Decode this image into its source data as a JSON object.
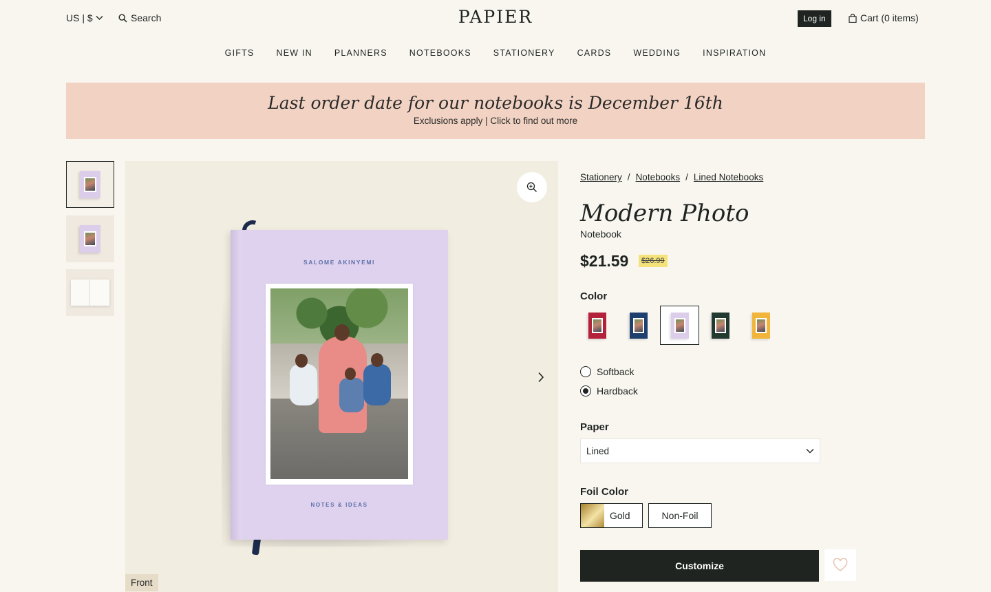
{
  "header": {
    "locale": "US | $",
    "search_label": "Search",
    "logo": "PAPIER",
    "login_label": "Log in",
    "cart_label": "Cart (0 items)"
  },
  "nav": [
    "GIFTS",
    "NEW IN",
    "PLANNERS",
    "NOTEBOOKS",
    "STATIONERY",
    "CARDS",
    "WEDDING",
    "INSPIRATION"
  ],
  "banner": {
    "title": "Last order date for our notebooks is December 16th",
    "subtitle": "Exclusions apply | Click to find out more",
    "color": "#f2d3c3"
  },
  "gallery": {
    "thumbnails": [
      "front-cover",
      "back-cover",
      "open-pages"
    ],
    "active_thumbnail": 0,
    "cover_author": "SALOME AKINYEMI",
    "cover_footer": "NOTES & IDEAS",
    "view_label": "Front"
  },
  "breadcrumb": [
    "Stationery",
    "Notebooks",
    "Lined Notebooks"
  ],
  "product": {
    "title": "Modern Photo",
    "subtitle": "Notebook",
    "price": "$21.59",
    "old_price": "$26.99"
  },
  "color": {
    "label": "Color",
    "options": [
      {
        "name": "red",
        "hex": "#b3213a"
      },
      {
        "name": "navy",
        "hex": "#1f3f6e"
      },
      {
        "name": "lilac",
        "hex": "#dccdea"
      },
      {
        "name": "forest",
        "hex": "#233a31"
      },
      {
        "name": "marigold",
        "hex": "#f0b53a"
      }
    ],
    "selected": 2
  },
  "binding": {
    "options": [
      "Softback",
      "Hardback"
    ],
    "selected": "Hardback"
  },
  "paper": {
    "label": "Paper",
    "value": "Lined"
  },
  "foil": {
    "label": "Foil Color",
    "options": [
      "Gold",
      "Non-Foil"
    ]
  },
  "actions": {
    "customize_label": "Customize",
    "wishlist_icon": "heart-icon"
  }
}
